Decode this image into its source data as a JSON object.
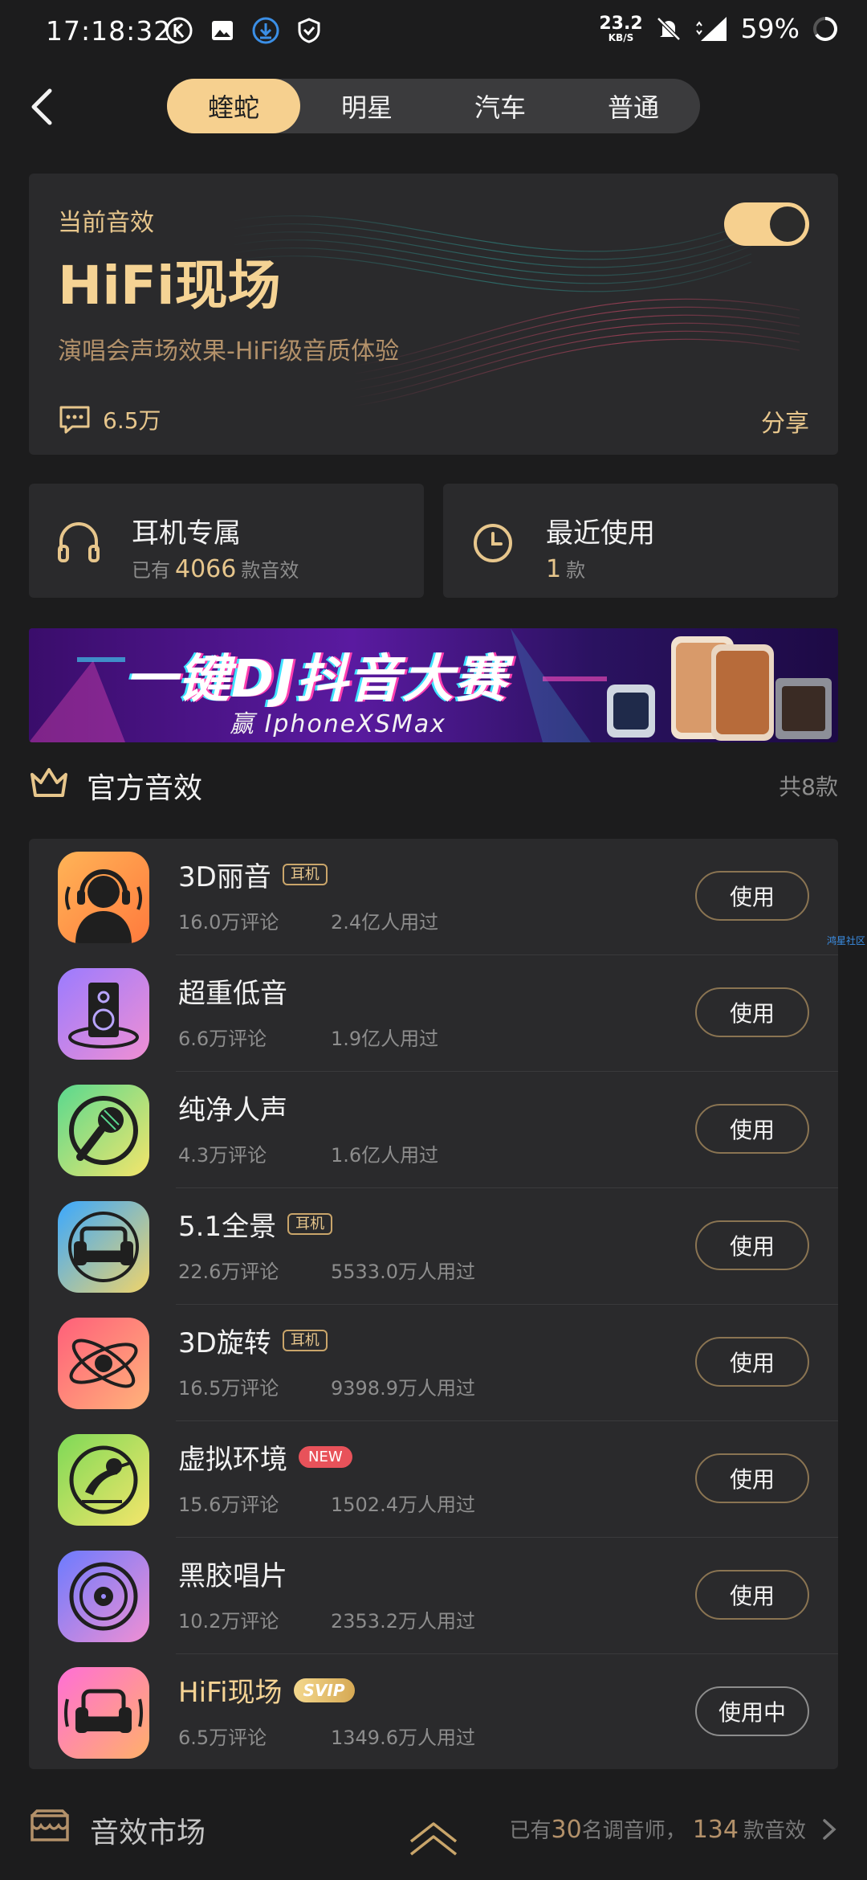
{
  "status_bar": {
    "time": "17:18:32",
    "net_speed": "23.2",
    "net_unit": "KB/S",
    "battery": "59%",
    "icons": [
      "k-icon",
      "image-icon",
      "download-icon",
      "shield-icon",
      "bell-off-icon",
      "signal-icon",
      "battery-ring-icon"
    ]
  },
  "nav": {
    "tabs": [
      {
        "label": "蝰蛇",
        "active": true
      },
      {
        "label": "明星",
        "active": false
      },
      {
        "label": "汽车",
        "active": false
      },
      {
        "label": "普通",
        "active": false
      }
    ]
  },
  "current_effect": {
    "label": "当前音效",
    "title": "HiFi现场",
    "description": "演唱会声场效果-HiFi级音质体验",
    "comments": "6.5万",
    "share": "分享",
    "enabled": true
  },
  "shortcuts": {
    "headphone": {
      "title": "耳机专属",
      "prefix": "已有",
      "count": "4066",
      "suffix": "款音效"
    },
    "recent": {
      "title": "最近使用",
      "count": "1",
      "suffix": "款"
    }
  },
  "banner": {
    "title": "一键DJ抖音大赛",
    "subtitle": "赢 IphoneXSMax"
  },
  "official": {
    "title": "官方音效",
    "count": "共8款",
    "items": [
      {
        "name": "3D丽音",
        "tag": "耳机",
        "tag_type": "normal",
        "comments": "16.0万评论",
        "users": "2.4亿人用过",
        "button": "使用"
      },
      {
        "name": "超重低音",
        "tag": "",
        "tag_type": "",
        "comments": "6.6万评论",
        "users": "1.9亿人用过",
        "button": "使用"
      },
      {
        "name": "纯净人声",
        "tag": "",
        "tag_type": "",
        "comments": "4.3万评论",
        "users": "1.6亿人用过",
        "button": "使用"
      },
      {
        "name": "5.1全景",
        "tag": "耳机",
        "tag_type": "normal",
        "comments": "22.6万评论",
        "users": "5533.0万人用过",
        "button": "使用"
      },
      {
        "name": "3D旋转",
        "tag": "耳机",
        "tag_type": "normal",
        "comments": "16.5万评论",
        "users": "9398.9万人用过",
        "button": "使用"
      },
      {
        "name": "虚拟环境",
        "tag": "NEW",
        "tag_type": "new",
        "comments": "15.6万评论",
        "users": "1502.4万人用过",
        "button": "使用"
      },
      {
        "name": "黑胶唱片",
        "tag": "",
        "tag_type": "",
        "comments": "10.2万评论",
        "users": "2353.2万人用过",
        "button": "使用"
      },
      {
        "name": "HiFi现场",
        "tag": "SVIP",
        "tag_type": "svip",
        "comments": "6.5万评论",
        "users": "1349.6万人用过",
        "button": "使用中"
      }
    ]
  },
  "side_note": "鸿星社区",
  "market": {
    "title": "音效市场",
    "prefix": "已有",
    "tuners": "30",
    "mid": "名调音师，",
    "effects": "134",
    "suffix": "款音效"
  }
}
